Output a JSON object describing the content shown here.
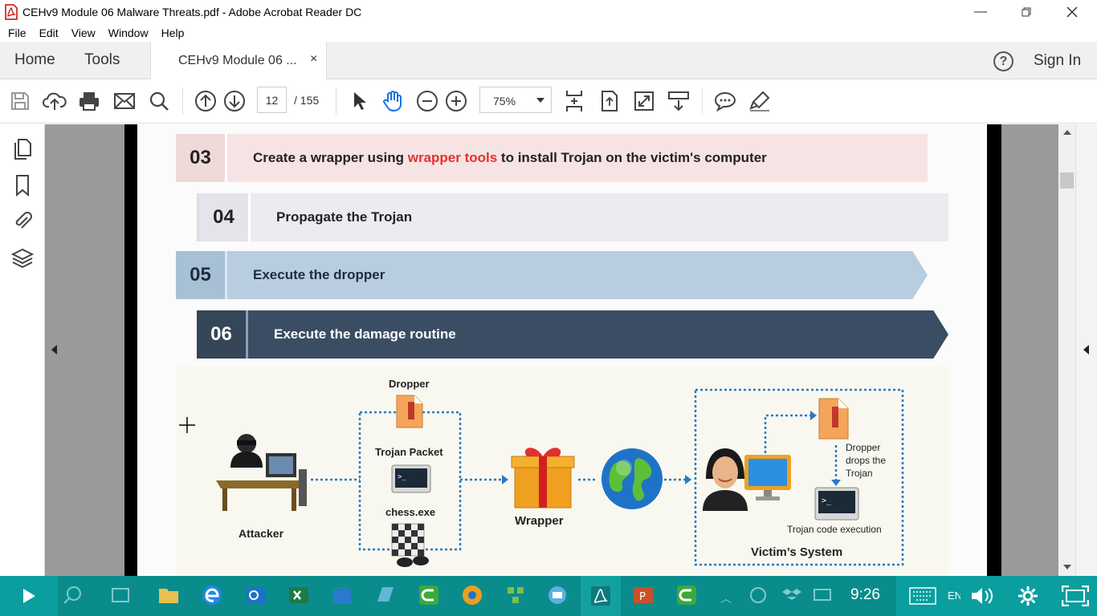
{
  "window": {
    "title": "CEHv9 Module 06 Malware Threats.pdf - Adobe Acrobat Reader DC"
  },
  "menu": [
    "File",
    "Edit",
    "View",
    "Window",
    "Help"
  ],
  "nav": {
    "home": "Home",
    "tools": "Tools",
    "tab_label": "CEHv9 Module 06 ...",
    "tab_close": "×",
    "help": "?",
    "signin": "Sign In"
  },
  "toolbar": {
    "page_current": "12",
    "page_total": "/ 155",
    "zoom": "75%"
  },
  "content": {
    "steps": [
      {
        "num": "03",
        "pre": "Create a wrapper using ",
        "highlight": "wrapper tools",
        "post": " to install Trojan on the victim's computer"
      },
      {
        "num": "04",
        "text": "Propagate the Trojan"
      },
      {
        "num": "05",
        "text": "Execute the dropper"
      },
      {
        "num": "06",
        "text": "Execute the damage routine"
      }
    ],
    "diagram": {
      "dropper": "Dropper",
      "trojan_packet": "Trojan Packet",
      "chess": "chess.exe",
      "attacker": "Attacker",
      "wrapper": "Wrapper",
      "dropper_drops": [
        "Dropper",
        "drops the",
        "Trojan"
      ],
      "trojan_exec": "Trojan code execution",
      "victim": "Victim’s System"
    }
  },
  "taskbar": {
    "time": "9:26",
    "lang": "EN"
  },
  "colors": {
    "highlight_red": "#e8312a",
    "step03_bg": "#f6e3e3",
    "step04_bg": "#ebebf2",
    "step05_bg": "#b8cde0",
    "step06_bg": "#3a4d62",
    "taskbar": "#0a8c8c",
    "link_blue": "#1473e6"
  }
}
